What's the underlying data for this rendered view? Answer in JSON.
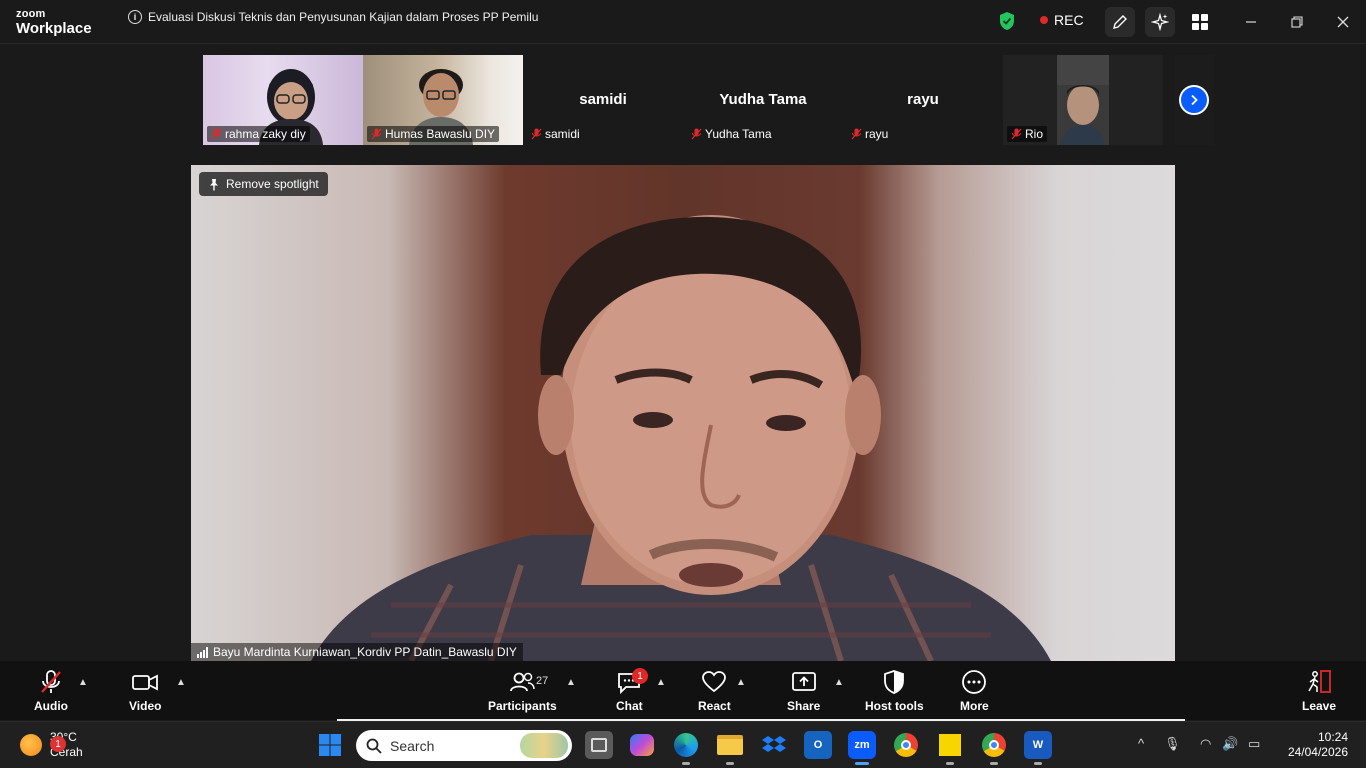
{
  "app": {
    "logo_line1": "zoom",
    "logo_line2": "Workplace"
  },
  "meeting": {
    "title": "Evaluasi Diskusi Teknis dan Penyusunan Kajian dalam Proses PP Pemilu",
    "rec_label": "REC"
  },
  "participants_strip": [
    {
      "name": "rahma zaky diy",
      "video": true,
      "muted": true
    },
    {
      "name": "Humas Bawaslu DIY",
      "video": true,
      "muted": true
    },
    {
      "name": "samidi",
      "video": false,
      "muted": true
    },
    {
      "name": "Yudha Tama",
      "video": false,
      "muted": true
    },
    {
      "name": "rayu",
      "video": false,
      "muted": true
    },
    {
      "name": "Rio",
      "video": true,
      "muted": true
    }
  ],
  "spotlight": {
    "remove_label": "Remove spotlight",
    "speaker_name": "Bayu Mardinta Kurniawan_Kordiv PP Datin_Bawaslu DIY"
  },
  "toolbar": {
    "audio": "Audio",
    "video": "Video",
    "participants": "Participants",
    "participants_count": "27",
    "chat": "Chat",
    "chat_badge": "1",
    "react": "React",
    "share": "Share",
    "host_tools": "Host tools",
    "more": "More",
    "leave": "Leave"
  },
  "taskbar": {
    "weather_temp": "30°C",
    "weather_desc": "Cerah",
    "weather_badge": "1",
    "search_placeholder": "Search",
    "time": "10:24",
    "date": "24/04/2026"
  },
  "colors": {
    "accent": "#0b5cff",
    "rec_red": "#e02828",
    "shield_green": "#22c55e"
  }
}
